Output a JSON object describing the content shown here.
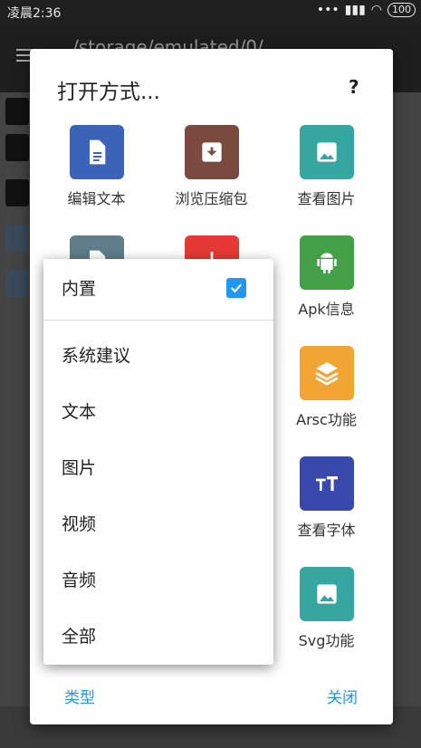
{
  "status": {
    "time": "凌晨2:36",
    "battery": "100"
  },
  "appbar": {
    "path": "/storage/emulated/0/"
  },
  "dialog": {
    "title": "打开方式...",
    "help": "?",
    "items": [
      {
        "label": "编辑文本",
        "color": "#3b63b8",
        "icon": "document-icon"
      },
      {
        "label": "浏览压缩包",
        "color": "#7a4a3e",
        "icon": "archive-icon"
      },
      {
        "label": "查看图片",
        "color": "#35a6a0",
        "icon": "image-icon"
      },
      {
        "label": "",
        "color": "#607d8b",
        "icon": "document-icon"
      },
      {
        "label": "",
        "color": "#e53935",
        "icon": "file-icon"
      },
      {
        "label": "Apk信息",
        "color": "#43a047",
        "icon": "android-icon"
      },
      {
        "label": "Arsc功能",
        "color": "#f2a533",
        "icon": "layers-icon"
      },
      {
        "label": "查看字体",
        "color": "#3949ab",
        "icon": "font-icon"
      },
      {
        "label": "Svg功能",
        "color": "#35a6a0",
        "icon": "image-icon"
      }
    ],
    "footer": {
      "type_label": "类型",
      "close_label": "关闭"
    }
  },
  "popup": {
    "items": [
      {
        "label": "内置",
        "checked": true
      },
      {
        "label": "系统建议"
      },
      {
        "label": "文本"
      },
      {
        "label": "图片"
      },
      {
        "label": "视频"
      },
      {
        "label": "音频"
      },
      {
        "label": "全部"
      }
    ]
  }
}
